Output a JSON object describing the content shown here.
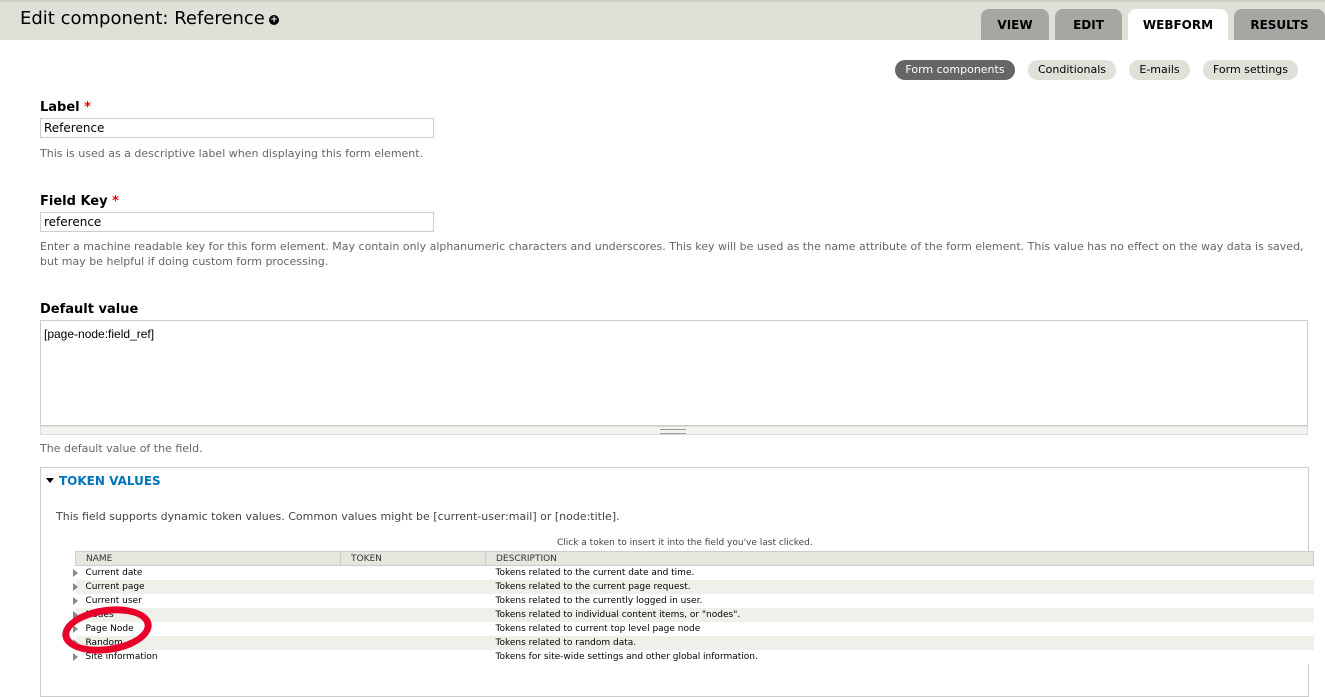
{
  "header": {
    "title": "Edit component: Reference",
    "tabs": [
      {
        "label": "VIEW"
      },
      {
        "label": "EDIT"
      },
      {
        "label": "WEBFORM"
      },
      {
        "label": "RESULTS"
      }
    ],
    "active_tab": "WEBFORM"
  },
  "secondary_tabs": [
    {
      "label": "Form components"
    },
    {
      "label": "Conditionals"
    },
    {
      "label": "E-mails"
    },
    {
      "label": "Form settings"
    }
  ],
  "form": {
    "label": {
      "title": "Label",
      "required_mark": "*",
      "value": "Reference",
      "description": "This is used as a descriptive label when displaying this form element."
    },
    "field_key": {
      "title": "Field Key",
      "required_mark": "*",
      "value": "reference",
      "description": "Enter a machine readable key for this form element. May contain only alphanumeric characters and underscores. This key will be used as the name attribute of the form element. This value has no effect on the way data is saved, but may be helpful if doing custom form processing."
    },
    "default_value": {
      "title": "Default value",
      "value": "[page-node:field_ref]",
      "description": "The default value of the field."
    }
  },
  "tokens": {
    "legend": "TOKEN VALUES",
    "description": "This field supports dynamic token values. Common values might be [current-user:mail] or [node:title].",
    "hint": "Click a token to insert it into the field you've last clicked.",
    "columns": [
      "NAME",
      "TOKEN",
      "DESCRIPTION"
    ],
    "rows": [
      {
        "name": "Current date",
        "token": "",
        "description": "Tokens related to the current date and time."
      },
      {
        "name": "Current page",
        "token": "",
        "description": "Tokens related to the current page request."
      },
      {
        "name": "Current user",
        "token": "",
        "description": "Tokens related to the currently logged in user."
      },
      {
        "name": "Nodes",
        "token": "",
        "description": "Tokens related to individual content items, or \"nodes\"."
      },
      {
        "name": "Page Node",
        "token": "",
        "description": "Tokens related to current top level page node"
      },
      {
        "name": "Random",
        "token": "",
        "description": "Tokens related to random data."
      },
      {
        "name": "Site information",
        "token": "",
        "description": "Tokens for site-wide settings and other global information."
      }
    ]
  },
  "colors": {
    "required": "#e00000",
    "link": "#0074bd",
    "annotation_circle": "#e8002a"
  },
  "icons": {
    "shortcut": "add-shortcut-icon",
    "collapse": "collapse-triangle-icon",
    "row_expand": "row-expand-triangle-icon"
  }
}
